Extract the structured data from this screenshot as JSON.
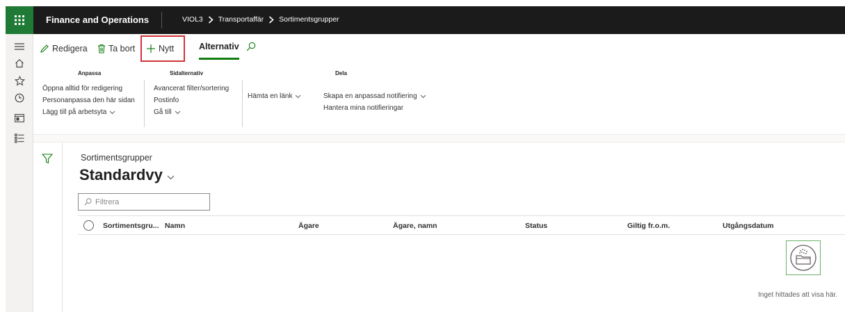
{
  "header": {
    "app_title": "Finance and Operations",
    "breadcrumb": [
      "VIOL3",
      "Transportaffär",
      "Sortimentsgrupper"
    ]
  },
  "icons": {
    "waffle": "waffle-icon",
    "rail": [
      "hamburger-icon",
      "home-icon",
      "star-icon",
      "clock-icon",
      "workspace-icon",
      "list-icon"
    ]
  },
  "actionbar": {
    "edit_label": "Redigera",
    "delete_label": "Ta bort",
    "new_label": "Nytt",
    "options_tab": "Alternativ"
  },
  "ribbon": {
    "anpassa": {
      "title": "Anpassa",
      "items": [
        "Öppna alltid för redigering",
        "Personanpassa den här sidan",
        "Lägg till på arbetsyta"
      ]
    },
    "sidalternativ": {
      "title": "Sidalternativ",
      "items": [
        "Avancerat filter/sortering",
        "Postinfo",
        "Gå till"
      ]
    },
    "dela": {
      "title": "Dela",
      "link_item": "Hämta en länk",
      "items": [
        "Skapa en anpassad notifiering",
        "Hantera mina notifieringar"
      ]
    }
  },
  "main": {
    "page_caption": "Sortimentsgrupper",
    "view_name": "Standardvy",
    "filter_placeholder": "Filtrera",
    "columns": [
      "Sortimentsgru...",
      "Namn",
      "Ägare",
      "Ägare, namn",
      "Status",
      "Giltig fr.o.m.",
      "Utgångsdatum"
    ],
    "empty_message": "Inget hittades att visa här."
  },
  "colors": {
    "topbar": "#1b1b1b",
    "brand_green": "#1f7a35",
    "tab_underline": "#107c10",
    "highlight_red": "#d13438"
  }
}
